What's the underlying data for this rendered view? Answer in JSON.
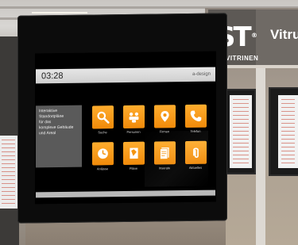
{
  "scene": {
    "booth_brand": {
      "logo": "ST",
      "registered": "®",
      "subtitle": "VITRINEN",
      "right_text": "Vitrun"
    }
  },
  "kiosk": {
    "clock": "03:28",
    "logo": "a-design",
    "info_text": "Interaktive\nStandortpläne\nfür das\nkomplexe Gebäude\nund Areal",
    "tiles": [
      {
        "label": "Suche",
        "icon": "search-icon"
      },
      {
        "label": "Personen",
        "icon": "people-icon"
      },
      {
        "label": "Firmen",
        "icon": "location-icon"
      },
      {
        "label": "Telefon",
        "icon": "phone-icon"
      },
      {
        "label": "Anlässe",
        "icon": "clock-icon"
      },
      {
        "label": "Pläne",
        "icon": "map-icon"
      },
      {
        "label": "Inserate",
        "icon": "document-icon"
      },
      {
        "label": "Aktuelles",
        "icon": "paperclip-icon"
      }
    ],
    "accent_color": "#f59a16"
  }
}
